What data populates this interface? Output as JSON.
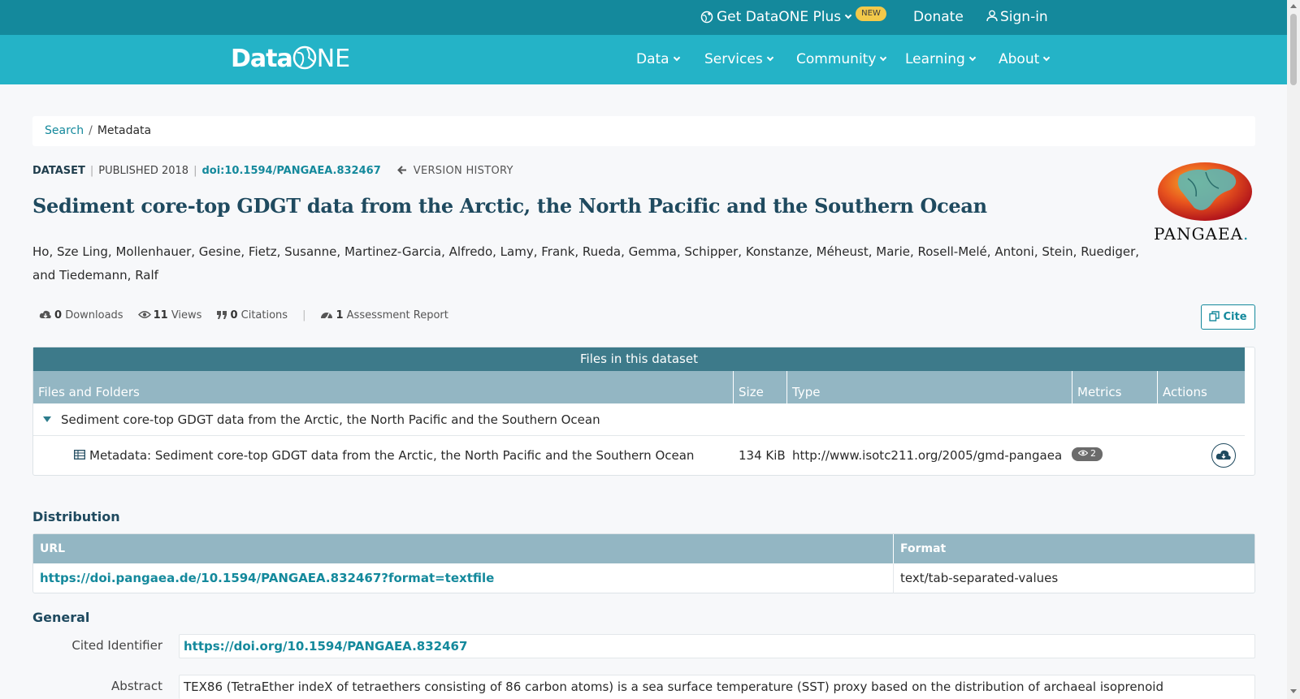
{
  "topbar": {
    "plus_label": "Get DataONE Plus",
    "new_badge": "NEW",
    "donate": "Donate",
    "signin": "Sign-in"
  },
  "nav": {
    "logo_data": "Data",
    "logo_one": "NE",
    "items": [
      "Data",
      "Services",
      "Community",
      "Learning",
      "About"
    ]
  },
  "breadcrumb": {
    "search": "Search",
    "separator": "/",
    "current": "Metadata"
  },
  "dataset": {
    "type": "DATASET",
    "published": "PUBLISHED 2018",
    "doi": "doi:10.1594/PANGAEA.832467",
    "version_history": "VERSION HISTORY",
    "title": "Sediment core-top GDGT data from the Arctic, the North Pacific and the Southern Ocean",
    "authors": "Ho, Sze Ling, Mollenhauer, Gesine, Fietz, Susanne, Martinez-Garcia, Alfredo, Lamy, Frank, Rueda, Gemma, Schipper, Konstanze, Méheust, Marie, Rosell-Melé, Antoni, Stein, Ruediger, and Tiedemann, Ralf",
    "repository_logo": "PANGAEA",
    "repository_logo_dot": "."
  },
  "stats": {
    "downloads_count": "0",
    "downloads_label": "Downloads",
    "views_count": "11",
    "views_label": "Views",
    "citations_count": "0",
    "citations_label": "Citations",
    "assessment_count": "1",
    "assessment_label": "Assessment Report",
    "cite_button": "Cite"
  },
  "files": {
    "header": "Files in this dataset",
    "columns": [
      "Files and Folders",
      "Size",
      "Type",
      "Metrics",
      "Actions"
    ],
    "folder_name": "Sediment core-top GDGT data from the Arctic, the North Pacific and the Southern Ocean",
    "file": {
      "name": "Metadata: Sediment core-top GDGT data from the Arctic, the North Pacific and the Southern Ocean",
      "size": "134 KiB",
      "type": "http://www.isotc211.org/2005/gmd-pangaea",
      "views": "2"
    }
  },
  "distribution": {
    "heading": "Distribution",
    "col_url": "URL",
    "col_format": "Format",
    "url": "https://doi.pangaea.de/10.1594/PANGAEA.832467?format=textfile",
    "format": "text/tab-separated-values"
  },
  "general": {
    "heading": "General",
    "cited_identifier_label": "Cited Identifier",
    "cited_identifier": "https://doi.org/10.1594/PANGAEA.832467",
    "abstract_label": "Abstract",
    "abstract": "TEX86 (TetraEther indeX of tetraethers consisting of 86 carbon atoms) is a sea surface temperature (SST) proxy based on the distribution of archaeal isoprenoid"
  },
  "colors": {
    "topbar": "#14899c",
    "nav": "#24b3c7",
    "accent": "#14899c",
    "title": "#1f4a5f",
    "table_header": "#93b6c3"
  }
}
